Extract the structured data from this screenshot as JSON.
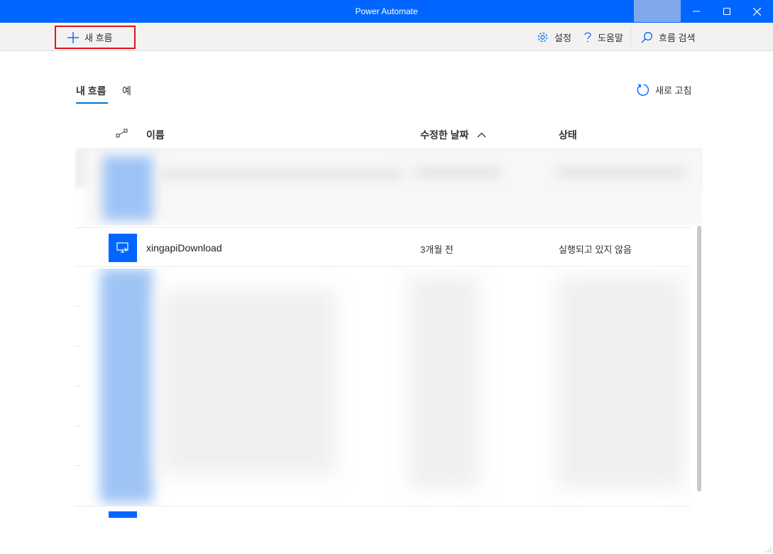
{
  "window": {
    "title": "Power Automate"
  },
  "toolbar": {
    "new_flow_label": "새 흐름",
    "settings_label": "설정",
    "help_label": "도움말",
    "search_label": "흐름 검색"
  },
  "tabs": [
    {
      "label": "내 흐름",
      "active": true
    },
    {
      "label": "예",
      "active": false
    }
  ],
  "refresh_label": "새로 고침",
  "table": {
    "headers": {
      "name": "이름",
      "modified": "수정한 날짜",
      "status": "상태"
    },
    "sort": "ascending",
    "rows": [
      {
        "name": "xingapiDownload",
        "modified": "3개월 전",
        "status": "실행되고 있지 않음"
      }
    ]
  },
  "colors": {
    "titlebar": "#0066ff",
    "accent": "#0078d4",
    "highlight_box": "#e0141e"
  }
}
